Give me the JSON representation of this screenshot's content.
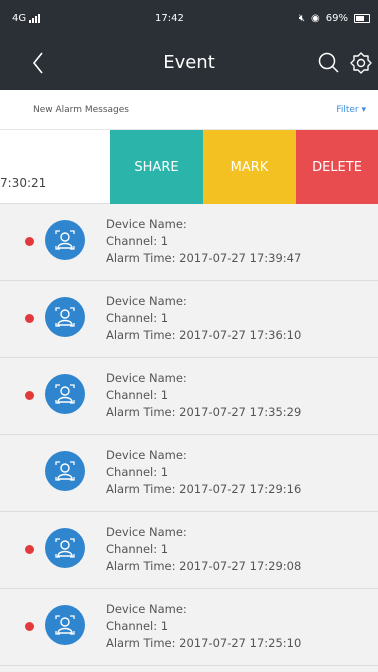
{
  "status_bar": {
    "network": "4G",
    "time": "17:42",
    "battery": "69%"
  },
  "nav": {
    "title": "Event",
    "back_icon": "chevron-left-icon",
    "search_icon": "search-icon",
    "settings_icon": "gear-icon"
  },
  "sub_header": {
    "label": "New Alarm Messages",
    "filter": "Filter ▾"
  },
  "swipe_row": {
    "time_partial": "7:30:21",
    "actions": {
      "share": "SHARE",
      "mark": "MARK",
      "delete": "DELETE"
    }
  },
  "events": [
    {
      "device": "Device Name:",
      "channel": "Channel: 1",
      "alarm_time": "Alarm Time: 2017-07-27 17:39:47",
      "unread": true
    },
    {
      "device": "Device Name:",
      "channel": "Channel: 1",
      "alarm_time": "Alarm Time: 2017-07-27 17:36:10",
      "unread": true
    },
    {
      "device": "Device Name:",
      "channel": "Channel: 1",
      "alarm_time": "Alarm Time: 2017-07-27 17:35:29",
      "unread": true
    },
    {
      "device": "Device Name:",
      "channel": "Channel: 1",
      "alarm_time": "Alarm Time: 2017-07-27 17:29:16",
      "unread": false
    },
    {
      "device": "Device Name:",
      "channel": "Channel: 1",
      "alarm_time": "Alarm Time: 2017-07-27 17:29:08",
      "unread": true
    },
    {
      "device": "Device Name:",
      "channel": "Channel: 1",
      "alarm_time": "Alarm Time: 2017-07-27 17:25:10",
      "unread": true
    }
  ],
  "colors": {
    "nav_bg": "#2a3036",
    "share": "#2bb4aa",
    "mark": "#f3c222",
    "delete": "#e84c4f",
    "unread_dot": "#e23a3a",
    "avatar": "#2f86cf",
    "filter": "#3a8de0"
  }
}
